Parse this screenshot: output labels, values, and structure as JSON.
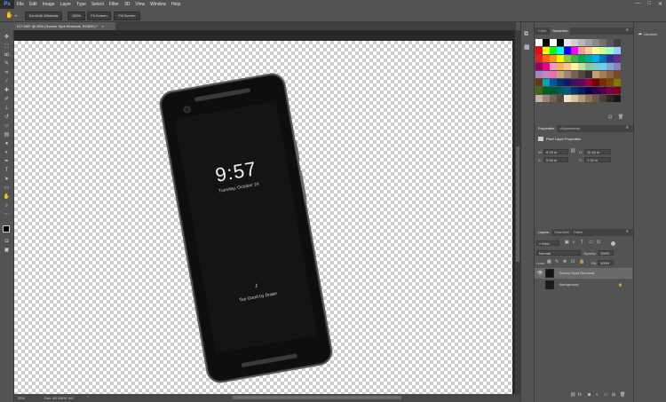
{
  "app": {
    "logo": "Ps"
  },
  "menu": [
    "File",
    "Edit",
    "Image",
    "Layer",
    "Type",
    "Select",
    "Filter",
    "3D",
    "View",
    "Window",
    "Help"
  ],
  "window_controls": [
    "—",
    "□",
    "✕"
  ],
  "options": {
    "scroll_all": "Scroll All Windows",
    "zoom": "100%",
    "fit_screen": "Fit Screen",
    "fill_screen": "Fill Screen"
  },
  "document": {
    "tab_title": "017.NEF @ 25% (Screen Spot Removal, RGB/8*) *",
    "tab_close": "×"
  },
  "phone": {
    "time": "9:57",
    "date": "Tuesday, October 24",
    "music_note": "♪",
    "song": "Too Good by Drake"
  },
  "status": {
    "zoom": "25%",
    "doc": "Doc: 65.0M/97.4M"
  },
  "panels": {
    "color_tab": "Color",
    "swatches_tab": "Swatches",
    "libraries": "Libraries",
    "properties_tab": "Properties",
    "adjustments_tab": "Adjustments",
    "prop_title": "Pixel Layer Properties",
    "W_label": "W:",
    "W": "6.23 in",
    "H_label": "H:",
    "H": "11.48 in",
    "X_label": "X:",
    "X": "5.94 in",
    "Y_label": "Y:",
    "Y": "1.32 in",
    "layers_tab": "Layers",
    "channels_tab": "Channels",
    "paths_tab": "Paths",
    "kind": "Kind",
    "blend": "Normal",
    "opacity_label": "Opacity:",
    "opacity": "100%",
    "lock_label": "Lock:",
    "fill_label": "Fill:",
    "fill": "100%",
    "layers": [
      {
        "name": "Screen Spot Removal"
      },
      {
        "name": "Background"
      }
    ]
  },
  "swatch_colors": [
    "#ffffff",
    "#000000",
    "#ffffff",
    "#000000",
    "#e8e8e8",
    "#d0d0d0",
    "#b8b8b8",
    "#a0a0a0",
    "#888888",
    "#707070",
    "#585858",
    "#404040",
    "#ff0000",
    "#ffff00",
    "#00ff00",
    "#00ffff",
    "#0000ff",
    "#ff00ff",
    "#ff9999",
    "#ffcc99",
    "#ffff99",
    "#ccff99",
    "#99ffcc",
    "#99ccff",
    "#ed1c24",
    "#f26522",
    "#f7941d",
    "#fff200",
    "#8dc63f",
    "#39b54a",
    "#00a651",
    "#00a99d",
    "#00aeef",
    "#0072bc",
    "#2e3192",
    "#662d91",
    "#9e005d",
    "#ec008c",
    "#f49ac2",
    "#fbaf5d",
    "#fdc689",
    "#fff799",
    "#c4df9b",
    "#82ca9c",
    "#7accc8",
    "#6dcff6",
    "#7da7d9",
    "#8781bd",
    "#a186be",
    "#bd8cbf",
    "#f06eaa",
    "#c6a47e",
    "#998675",
    "#736357",
    "#534741",
    "#362f2d",
    "#c69c6d",
    "#a67c52",
    "#8c6239",
    "#754c24",
    "#603913",
    "#00a8b5",
    "#0054a6",
    "#003471",
    "#1b1464",
    "#440e62",
    "#630460",
    "#9e0039",
    "#790000",
    "#7a2e00",
    "#7d4900",
    "#827b00",
    "#406618",
    "#005e20",
    "#005826",
    "#005952",
    "#005b7f",
    "#003663",
    "#002157",
    "#0d004c",
    "#32004b",
    "#4b0049",
    "#7b0046",
    "#7a0026",
    "#c7b299",
    "#998675",
    "#736357",
    "#534741",
    "#f2e3c9",
    "#d9c29e",
    "#b59b72",
    "#8c7553",
    "#6b5b46",
    "#4a3f33",
    "#2e2720",
    "#1a1612"
  ]
}
